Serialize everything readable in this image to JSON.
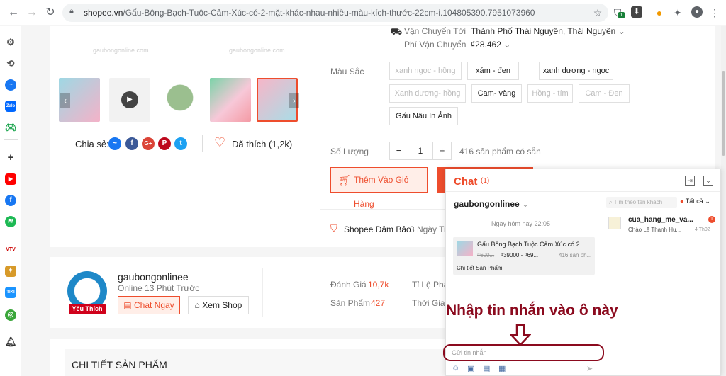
{
  "browser": {
    "url_host": "shopee.vn",
    "url_path": "/Gấu-Bông-Bạch-Tuộc-Cảm-Xúc-có-2-mặt-khác-nhau-nhiều-màu-kích-thước-22cm-i.104805390.7951073960",
    "ext_badge": "1"
  },
  "product": {
    "watermark": "gaubongonline.com",
    "shipping_to_label": "Vận Chuyển Tới",
    "shipping_to_value": "Thành Phố Thái Nguyên, Thái Nguyên",
    "shipping_fee_label": "Phí Vận Chuyển",
    "shipping_fee_value": "₫28.462",
    "color_label": "Màu Sắc",
    "colors": [
      {
        "label": "xanh ngọc - hồng",
        "disabled": true
      },
      {
        "label": "xám - đen",
        "disabled": false
      },
      {
        "label": "xanh dương - ngọc",
        "disabled": false
      },
      {
        "label": "Xanh dương- hồng",
        "disabled": true
      },
      {
        "label": "Cam- vàng",
        "disabled": false
      },
      {
        "label": "Hồng - tím",
        "disabled": true
      },
      {
        "label": "Cam - Đen",
        "disabled": true
      },
      {
        "label": "Gấu Nâu In Ảnh",
        "disabled": false
      }
    ],
    "qty_label": "Số Lượng",
    "qty_value": "1",
    "qty_minus": "−",
    "qty_plus": "+",
    "stock": "416 sản phẩm có sẵn",
    "add_to_cart": "Thêm Vào Giỏ Hàng",
    "guarantee": "Shopee Đảm Bảo",
    "guarantee_extra": "3 Ngày Tr",
    "share_label": "Chia sẻ:",
    "liked": "Đã thích (1,2k)"
  },
  "shop": {
    "name": "gaubongonlinee",
    "online": "Online 13 Phút Trước",
    "badge": "Yêu Thích",
    "chat_now": "Chat Ngay",
    "view_shop": "Xem Shop",
    "rating_label": "Đánh Giá",
    "rating_value": "10,7k",
    "products_label": "Sản Phẩm",
    "products_value": "427",
    "reply_label": "Tỉ Lệ Phản",
    "time_label": "Thời Gian"
  },
  "detail_title": "CHI TIẾT SẢN PHẨM",
  "chat": {
    "title": "Chat",
    "count": "(1)",
    "partner": "gaubongonlinee",
    "date": "Ngày hôm nay 22:05",
    "msg_title": "Gấu Bông Bạch Tuộc Cảm Xúc có 2 ...",
    "msg_old_price": "₫600...",
    "msg_price": "₫39000 - ₫69...",
    "msg_stock": "416 sản ph...",
    "msg_link": "Chi tiết Sản Phẩm",
    "input_placeholder": "Gửi tin nhắn",
    "search_placeholder": "Tìm theo tên khách",
    "filter": "Tất cả",
    "conv_name": "cua_hang_me_va...",
    "conv_preview": "Chào Lê Thanh Hu...",
    "conv_date": "4 Th02",
    "conv_badge": "1",
    "annotation": "Nhập tin nhắn vào ô này",
    "accent": "#ee4d2d",
    "annotation_color": "#8b0a1e"
  }
}
